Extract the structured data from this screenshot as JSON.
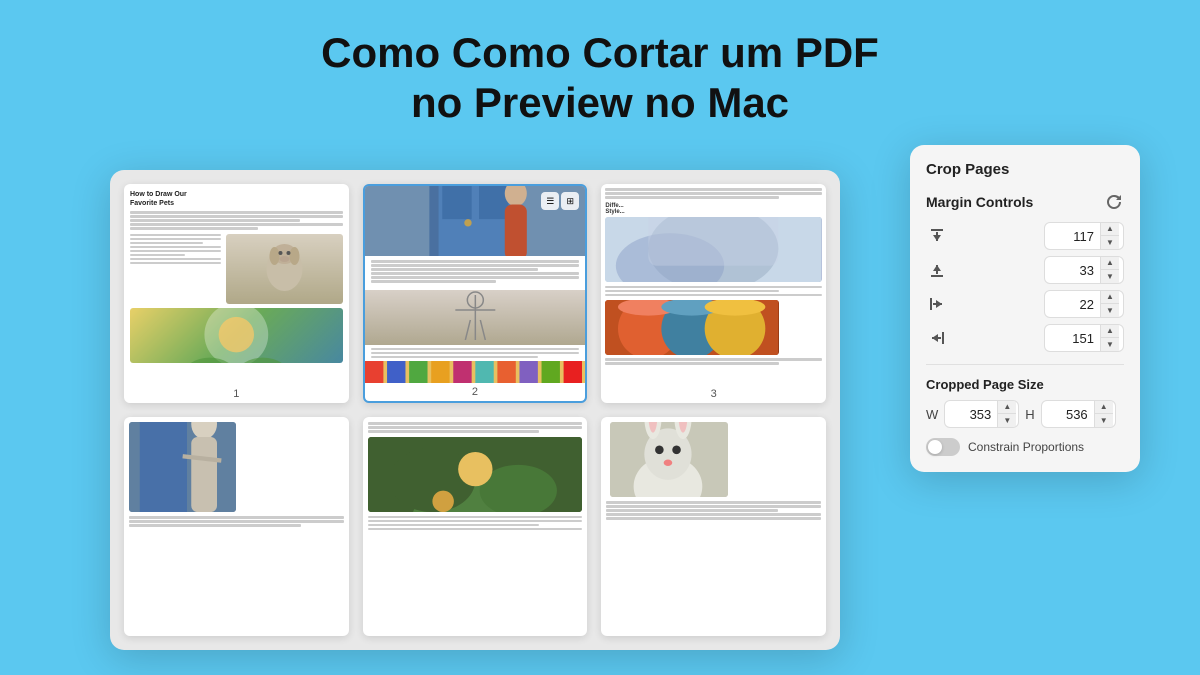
{
  "title": {
    "line1": "Como Como Cortar um PDF",
    "line2": "no Preview no Mac"
  },
  "crop_panel": {
    "title": "Crop Pages",
    "margin_controls_label": "Margin Controls",
    "margins": {
      "top": {
        "value": "117",
        "icon": "top-margin-icon"
      },
      "bottom": {
        "value": "33",
        "icon": "bottom-margin-icon"
      },
      "left": {
        "value": "22",
        "icon": "left-margin-icon"
      },
      "right": {
        "value": "151",
        "icon": "right-margin-icon"
      }
    },
    "cropped_page_size_label": "Cropped Page Size",
    "width_label": "W",
    "height_label": "H",
    "width_value": "353",
    "height_value": "536",
    "constrain_label": "Constrain Proportions"
  },
  "pages": [
    {
      "number": "1"
    },
    {
      "number": "2"
    },
    {
      "number": "3"
    },
    {
      "number": ""
    },
    {
      "number": ""
    },
    {
      "number": ""
    }
  ]
}
